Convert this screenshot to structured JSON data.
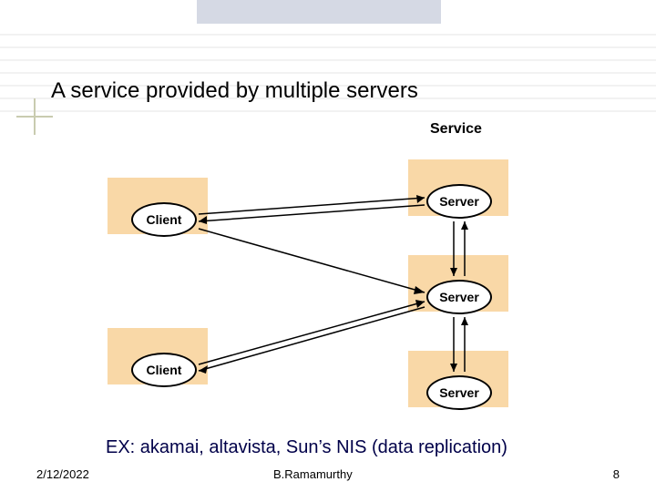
{
  "title": "A service provided by multiple servers",
  "caption": "EX: akamai, altavista, Sun’s NIS (data replication)",
  "footer": {
    "date": "2/12/2022",
    "author": "B.Ramamurthy",
    "page": "8"
  },
  "diagram": {
    "service_label": "Service",
    "nodes": {
      "client1": "Client",
      "client2": "Client",
      "server1": "Server",
      "server2": "Server",
      "server3": "Server"
    }
  }
}
